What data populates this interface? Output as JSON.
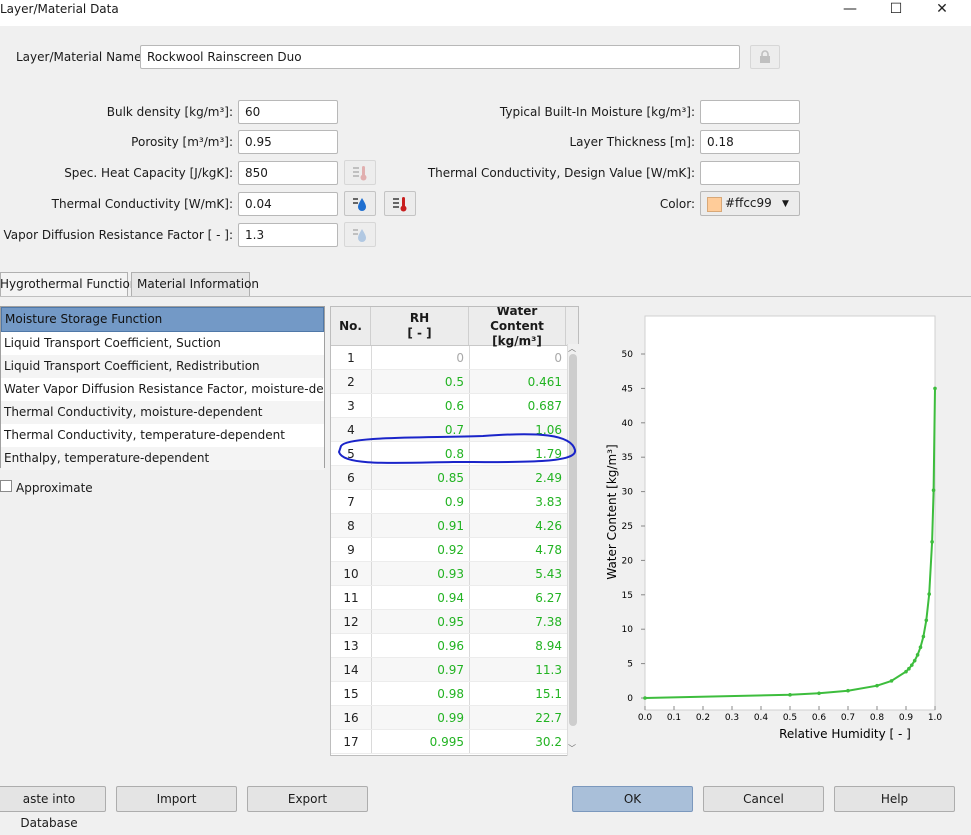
{
  "window": {
    "title": "Layer/Material Data",
    "minimize_glyph": "—",
    "maximize_glyph": "☐",
    "close_glyph": "✕"
  },
  "material": {
    "name_label": "Layer/Material Name:",
    "name_value": "Rockwool Rainscreen Duo",
    "lock_icon": "lock-icon"
  },
  "props_left": [
    {
      "label": "Bulk density [kg/m³]:",
      "value": "60"
    },
    {
      "label": "Porosity [m³/m³]:",
      "value": "0.95"
    },
    {
      "label": "Spec. Heat Capacity [J/kgK]:",
      "value": "850"
    },
    {
      "label": "Thermal Conductivity [W/mK]:",
      "value": "0.04"
    },
    {
      "label": "Water Vapor Diffusion Resistance Factor [ - ]:",
      "value": "1.3"
    }
  ],
  "props_right": [
    {
      "label": "Typical Built-In Moisture [kg/m³]:",
      "value": ""
    },
    {
      "label": "Layer Thickness [m]:",
      "value": "0.18"
    },
    {
      "label": "Thermal Conductivity, Design Value [W/mK]:",
      "value": ""
    }
  ],
  "color": {
    "label": "Color:",
    "value": "#ffcc99",
    "swatch": "#ffcc99"
  },
  "tabs": [
    {
      "label": "Hygrothermal Functions"
    },
    {
      "label": "Material Information"
    }
  ],
  "functions": [
    "Moisture Storage Function",
    "Liquid Transport Coefficient, Suction",
    "Liquid Transport Coefficient, Redistribution",
    "Water Vapor Diffusion Resistance Factor, moisture-depen...",
    "Thermal Conductivity, moisture-dependent",
    "Thermal Conductivity, temperature-dependent",
    "Enthalpy, temperature-dependent"
  ],
  "approximate_label": "Approximate",
  "table": {
    "col_no": "No.",
    "col_rh": "RH",
    "col_rh_unit": "[ - ]",
    "col_wc": "Water Content",
    "col_wc_unit": "[kg/m³]",
    "rows": [
      {
        "no": "1",
        "rh": "0",
        "wc": "0"
      },
      {
        "no": "2",
        "rh": "0.5",
        "wc": "0.461"
      },
      {
        "no": "3",
        "rh": "0.6",
        "wc": "0.687"
      },
      {
        "no": "4",
        "rh": "0.7",
        "wc": "1.06"
      },
      {
        "no": "5",
        "rh": "0.8",
        "wc": "1.79"
      },
      {
        "no": "6",
        "rh": "0.85",
        "wc": "2.49"
      },
      {
        "no": "7",
        "rh": "0.9",
        "wc": "3.83"
      },
      {
        "no": "8",
        "rh": "0.91",
        "wc": "4.26"
      },
      {
        "no": "9",
        "rh": "0.92",
        "wc": "4.78"
      },
      {
        "no": "10",
        "rh": "0.93",
        "wc": "5.43"
      },
      {
        "no": "11",
        "rh": "0.94",
        "wc": "6.27"
      },
      {
        "no": "12",
        "rh": "0.95",
        "wc": "7.38"
      },
      {
        "no": "13",
        "rh": "0.96",
        "wc": "8.94"
      },
      {
        "no": "14",
        "rh": "0.97",
        "wc": "11.3"
      },
      {
        "no": "15",
        "rh": "0.98",
        "wc": "15.1"
      },
      {
        "no": "16",
        "rh": "0.99",
        "wc": "22.7"
      },
      {
        "no": "17",
        "rh": "0.995",
        "wc": "30.2"
      }
    ]
  },
  "chart_data": {
    "type": "line",
    "xlabel": "Relative Humidity [ - ]",
    "ylabel": "Water Content [kg/m³]",
    "xlim": [
      0,
      1.0
    ],
    "ylim": [
      0,
      50
    ],
    "xticks": [
      "0.0",
      "0.1",
      "0.2",
      "0.3",
      "0.4",
      "0.5",
      "0.6",
      "0.7",
      "0.8",
      "0.9",
      "1.0"
    ],
    "yticks": [
      "0",
      "5",
      "10",
      "15",
      "20",
      "25",
      "30",
      "35",
      "40",
      "45",
      "50"
    ],
    "grid": false,
    "color": "#3dbd3d",
    "x": [
      0,
      0.5,
      0.6,
      0.7,
      0.8,
      0.85,
      0.9,
      0.91,
      0.92,
      0.93,
      0.94,
      0.95,
      0.96,
      0.97,
      0.98,
      0.99,
      0.995,
      1.0
    ],
    "y": [
      0,
      0.461,
      0.687,
      1.06,
      1.79,
      2.49,
      3.83,
      4.26,
      4.78,
      5.43,
      6.27,
      7.38,
      8.94,
      11.3,
      15.1,
      22.7,
      30.2,
      45
    ]
  },
  "buttons": {
    "paste": "aste into Database",
    "import": "Import",
    "export": "Export",
    "ok": "OK",
    "cancel": "Cancel",
    "help": "Help"
  },
  "annotation_color": "#1a24c9"
}
